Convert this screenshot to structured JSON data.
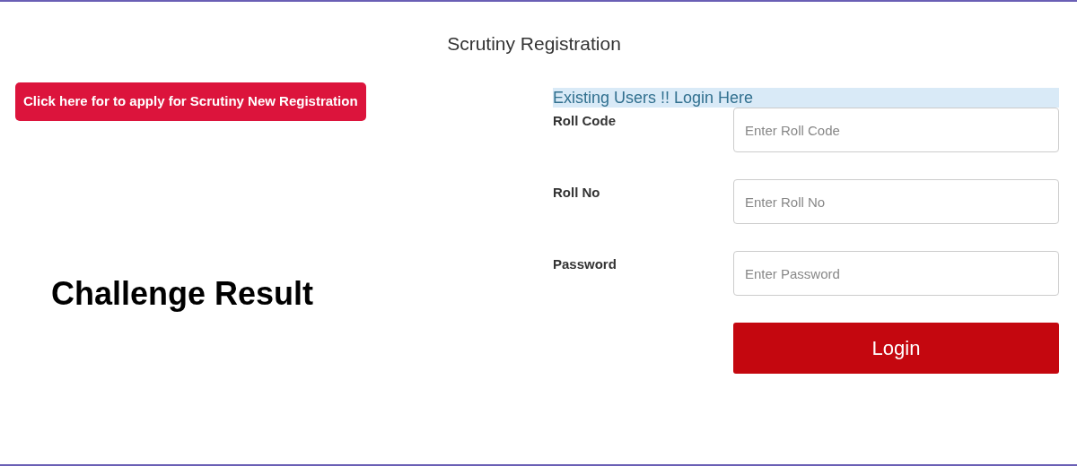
{
  "page_title": "Scrutiny Registration",
  "new_registration_button": "Click here for to apply for Scrutiny New Registration",
  "challenge_heading": "Challenge Result",
  "login_panel": {
    "heading": "Existing Users !! Login Here",
    "fields": [
      {
        "label": "Roll Code",
        "placeholder": "Enter Roll Code"
      },
      {
        "label": "Roll No",
        "placeholder": "Enter Roll No"
      },
      {
        "label": "Password",
        "placeholder": "Enter Password"
      }
    ],
    "submit_button": "Login"
  }
}
